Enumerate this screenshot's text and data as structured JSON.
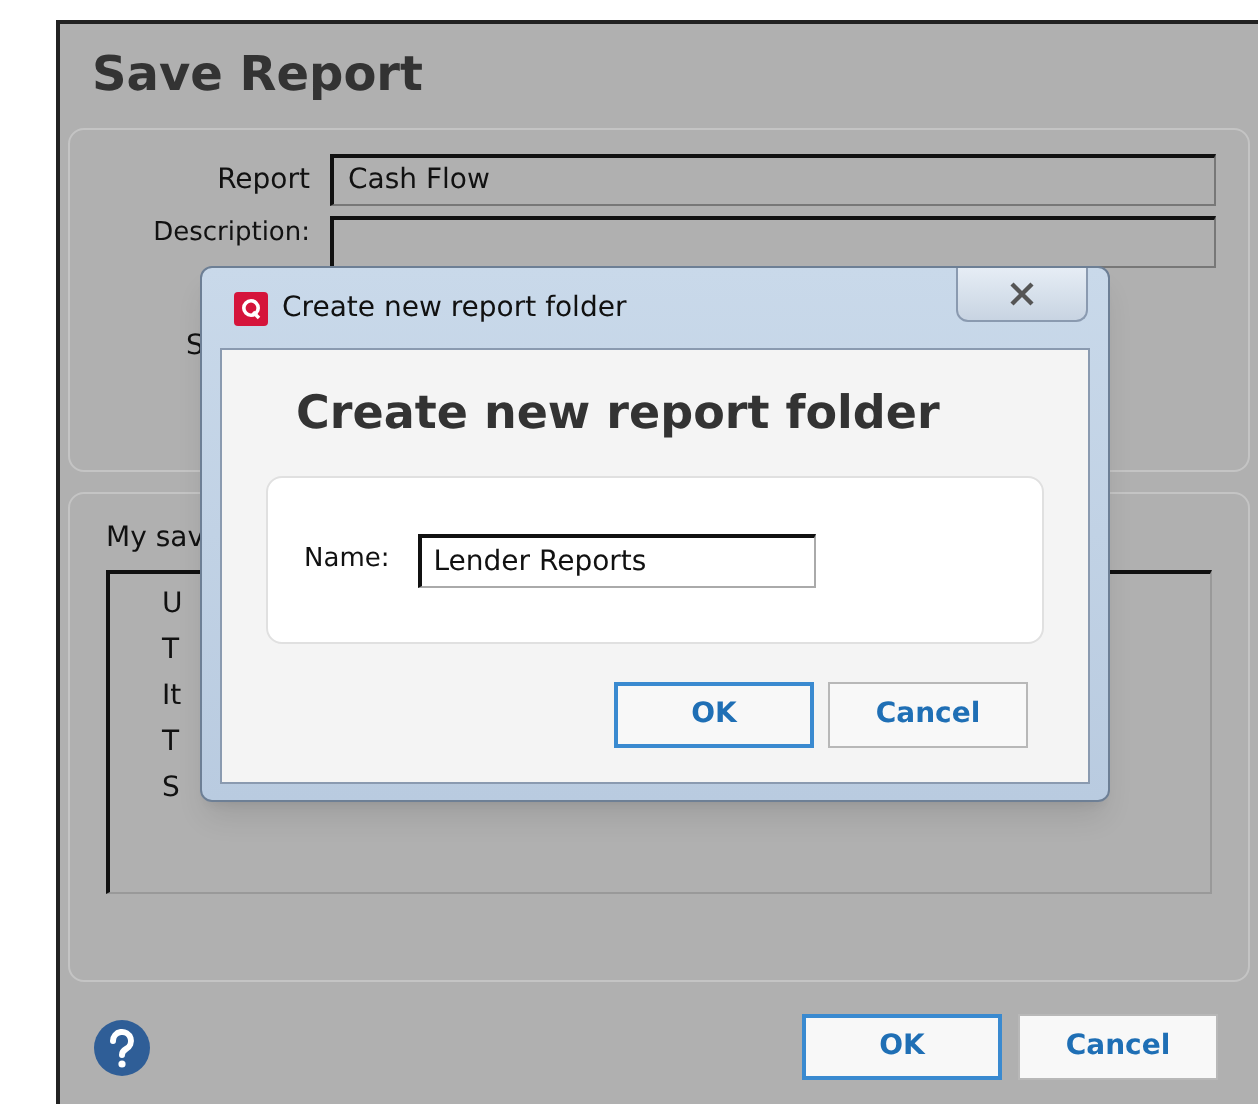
{
  "window": {
    "title": "Save Report"
  },
  "form": {
    "report_label": "Report",
    "report_value": "Cash Flow",
    "description_label": "Description:",
    "partial_label": "S"
  },
  "saved": {
    "label": "My sav",
    "items": [
      "U",
      "T",
      "It",
      "T",
      "S"
    ]
  },
  "buttons": [
    "OK",
    "Cancel"
  ],
  "dialog": {
    "title": "Create new report folder",
    "heading": "Create new report folder",
    "name_label": "Name:",
    "name_value": "Lender Reports",
    "buttons": [
      {
        "label": "OK",
        "default": true
      },
      {
        "label": "Cancel",
        "default": false
      }
    ]
  }
}
